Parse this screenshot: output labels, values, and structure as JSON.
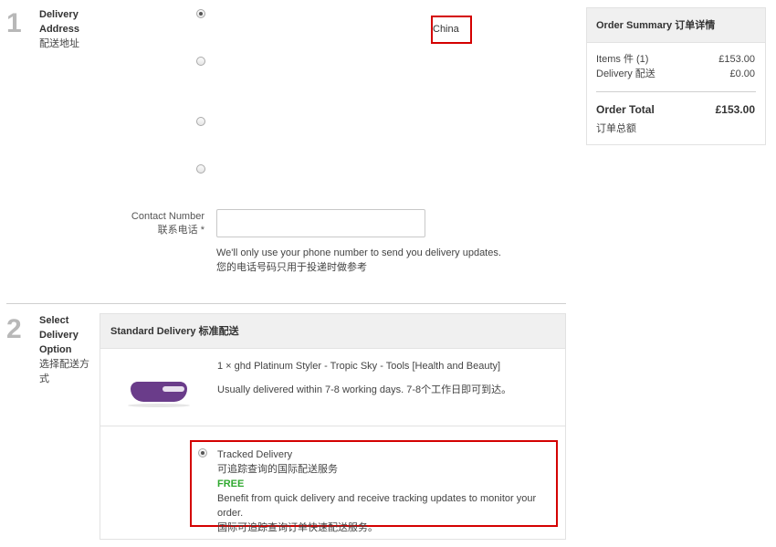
{
  "step1": {
    "number": "1",
    "title_line1": "Delivery",
    "title_line2": "Address",
    "title_cn": "配送地址",
    "country": "China",
    "contact_label": "Contact Number",
    "contact_label_cn": "联系电话 *",
    "contact_value": "",
    "help_en": "We'll only use your phone number to send you delivery updates.",
    "help_cn": "您的电话号码只用于投递时做参考"
  },
  "step2": {
    "number": "2",
    "title_line1": "Select",
    "title_line2": "Delivery",
    "title_line3": "Option",
    "title_cn_line1": "选择配送方",
    "title_cn_line2": "式",
    "panel_title": "Standard Delivery 标准配送",
    "item_line": "1 × ghd Platinum Styler - Tropic Sky - Tools [Health and Beauty]",
    "delivery_note": "Usually delivered within 7-8 working days. 7-8个工作日即可到达。",
    "option": {
      "name": "Tracked Delivery",
      "name_cn": "可追踪查询的国际配送服务",
      "price": "FREE",
      "desc_en": "Benefit from quick delivery and receive tracking updates to monitor your order.",
      "desc_cn": "国际可追踪查询订单快速配送服务。",
      "selected": true
    }
  },
  "summary": {
    "title": "Order Summary 订单详情",
    "items_label": "Items 件 (1)",
    "items_value": "£153.00",
    "delivery_label": "Delivery 配送",
    "delivery_value": "£0.00",
    "total_label": "Order Total",
    "total_label_cn": "订单总额",
    "total_value": "£153.00"
  },
  "colors": {
    "highlight": "#d40000",
    "free": "#2fa82f",
    "step_number": "#b8b8b8",
    "product": "#6a3c8a"
  },
  "icons": {
    "product_image": "purple-styler-pouch"
  }
}
